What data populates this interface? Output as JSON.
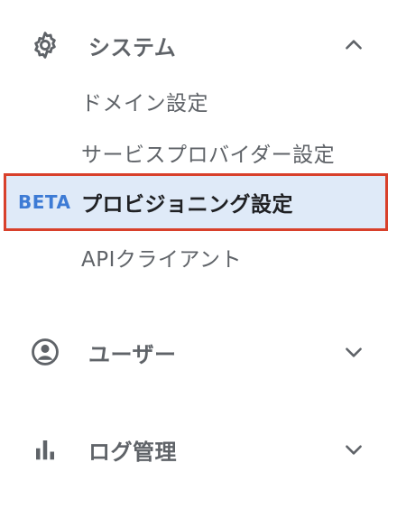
{
  "sections": {
    "system": {
      "label": "システム",
      "icon": "gear-icon",
      "expanded": true,
      "chevron": "chevron-up-icon",
      "items": [
        {
          "label": "ドメイン設定"
        },
        {
          "label": "サービスプロバイダー設定"
        },
        {
          "label": "プロビジョニング設定",
          "badge": "BETA",
          "active": true
        },
        {
          "label": "APIクライアント"
        }
      ]
    },
    "users": {
      "label": "ユーザー",
      "icon": "account-circle-icon",
      "expanded": false,
      "chevron": "chevron-down-icon"
    },
    "logs": {
      "label": "ログ管理",
      "icon": "bar-chart-icon",
      "expanded": false,
      "chevron": "chevron-down-icon"
    }
  },
  "colors": {
    "text": "#5f6368",
    "active_text": "#202124",
    "active_bg": "#dfeaf8",
    "highlight_border": "#d8402b",
    "badge": "#3d7bd5"
  }
}
